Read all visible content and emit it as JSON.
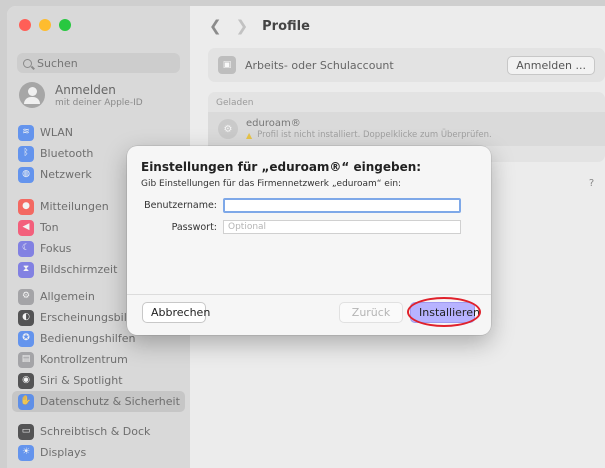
{
  "window": {
    "title": "Profile"
  },
  "sidebar": {
    "search_placeholder": "Suchen",
    "account": {
      "name": "Anmelden",
      "sub": "mit deiner Apple-ID"
    },
    "items": [
      {
        "label": "WLAN",
        "icon": "wifi-icon",
        "color": "#3478f6"
      },
      {
        "label": "Bluetooth",
        "icon": "bluetooth-icon",
        "color": "#3478f6"
      },
      {
        "label": "Netzwerk",
        "icon": "globe-icon",
        "color": "#3478f6"
      },
      {
        "label": "Mitteilungen",
        "icon": "bell-icon",
        "color": "#ff3b30"
      },
      {
        "label": "Ton",
        "icon": "speaker-icon",
        "color": "#ff2d55"
      },
      {
        "label": "Fokus",
        "icon": "moon-icon",
        "color": "#5e5ce6"
      },
      {
        "label": "Bildschirmzeit",
        "icon": "hourglass-icon",
        "color": "#5e5ce6"
      },
      {
        "label": "Allgemein",
        "icon": "gear-icon",
        "color": "#8e8e93"
      },
      {
        "label": "Erscheinungsbild",
        "icon": "appearance-icon",
        "color": "#1c1c1e"
      },
      {
        "label": "Bedienungshilfen",
        "icon": "accessibility-icon",
        "color": "#3478f6"
      },
      {
        "label": "Kontrollzentrum",
        "icon": "control-center-icon",
        "color": "#8e8e93"
      },
      {
        "label": "Siri & Spotlight",
        "icon": "siri-icon",
        "color": "#1c1c1e"
      },
      {
        "label": "Datenschutz & Sicherheit",
        "icon": "hand-icon",
        "color": "#3478f6"
      },
      {
        "label": "Schreibtisch & Dock",
        "icon": "dock-icon",
        "color": "#1c1c1e"
      },
      {
        "label": "Displays",
        "icon": "display-icon",
        "color": "#3478f6"
      }
    ],
    "selected": "Datenschutz & Sicherheit"
  },
  "main": {
    "work_account_label": "Arbeits- oder Schulaccount",
    "anmelden_button": "Anmelden ...",
    "section_label": "Geladen",
    "profile": {
      "name": "eduroam®",
      "warning": "Profil ist nicht installiert. Doppelklicke zum Überprüfen."
    },
    "help": "?"
  },
  "dialog": {
    "title": "Einstellungen für „eduroam®“ eingeben:",
    "subtitle": "Gib Einstellungen für das Firmennetzwerk „eduroam“ ein:",
    "username_label": "Benutzername:",
    "username_value": "",
    "password_label": "Passwort:",
    "password_placeholder": "Optional",
    "cancel_button": "Abbrechen",
    "back_button": "Zurück",
    "install_button": "Installieren"
  },
  "colors": {
    "install_accent": "#b7b3ff",
    "highlight_ring": "#e0212b",
    "focus_ring": "#7ea8e8"
  }
}
